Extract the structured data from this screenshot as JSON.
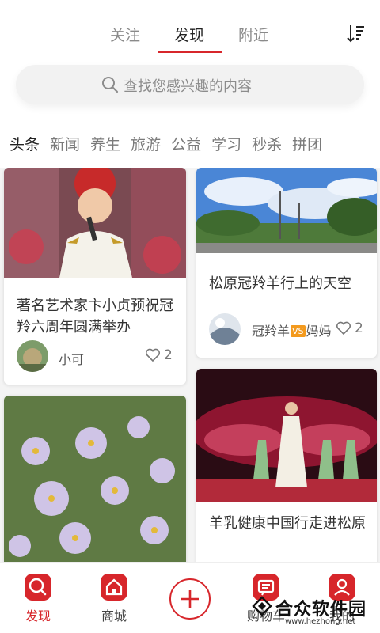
{
  "top_tabs": [
    {
      "label": "关注"
    },
    {
      "label": "发现"
    },
    {
      "label": "附近"
    }
  ],
  "sort_icon": "sort-icon",
  "search": {
    "placeholder": "查找您感兴趣的内容"
  },
  "categories": [
    "头条",
    "新闻",
    "养生",
    "旅游",
    "公益",
    "学习",
    "秒杀",
    "拼团"
  ],
  "active_category": "头条",
  "cards": [
    {
      "title": "著名艺术家卞小贞预祝冠羚六周年圆满举办",
      "author": "小可",
      "likes": "2"
    },
    {
      "title": "松原冠羚羊行上的天空",
      "author_left": "冠羚羊",
      "vs": "VS",
      "author_right": "妈妈",
      "likes": "2"
    },
    {
      "title": ""
    },
    {
      "title": "羊乳健康中国行走进松原"
    }
  ],
  "bottom_nav": [
    {
      "label": "发现",
      "icon": "discover-icon"
    },
    {
      "label": "商城",
      "icon": "home-shop-icon"
    },
    {
      "label": "购物车",
      "icon": "cart-icon"
    },
    {
      "label": "我的",
      "icon": "user-icon"
    }
  ],
  "watermark": {
    "text": "合众软件园",
    "url": "www.hezhong.net"
  },
  "colors": {
    "accent": "#d7262b",
    "vs_badge": "#f39a1e",
    "search_bg": "#f2f2f2"
  }
}
